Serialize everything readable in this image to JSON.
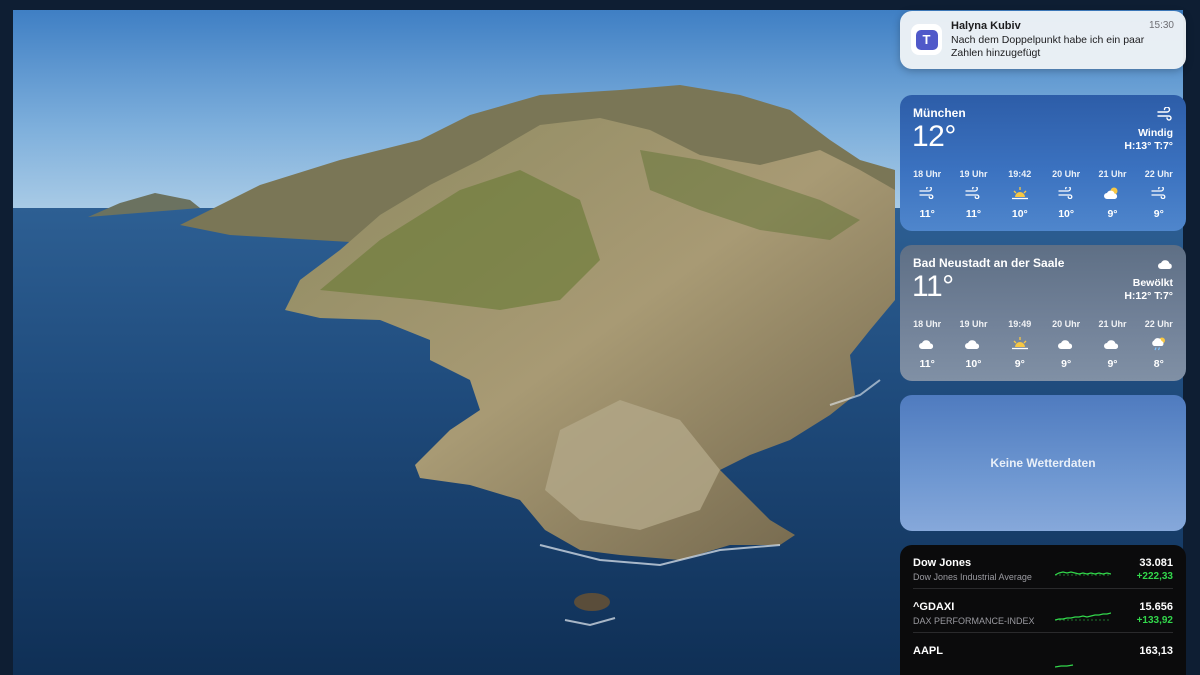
{
  "notification": {
    "app_icon": "microsoft-teams-icon",
    "sender": "Halyna Kubiv",
    "time": "15:30",
    "message": "Nach dem Doppelpunkt habe ich ein paar Zahlen hinzugefügt"
  },
  "weather": [
    {
      "city": "München",
      "temperature": "12°",
      "condition_icon": "wind-icon",
      "condition": "Windig",
      "hilo": "H:13° T:7°",
      "hours": [
        {
          "time": "18 Uhr",
          "icon": "wind-icon",
          "temp": "11°"
        },
        {
          "time": "19 Uhr",
          "icon": "wind-icon",
          "temp": "11°"
        },
        {
          "time": "19:42",
          "icon": "sunset-icon",
          "temp": "10°"
        },
        {
          "time": "20 Uhr",
          "icon": "wind-icon",
          "temp": "10°"
        },
        {
          "time": "21 Uhr",
          "icon": "partly-cloudy-icon",
          "temp": "9°"
        },
        {
          "time": "22 Uhr",
          "icon": "wind-icon",
          "temp": "9°"
        }
      ]
    },
    {
      "city": "Bad Neustadt an der Saale",
      "temperature": "11°",
      "condition_icon": "cloud-icon",
      "condition": "Bewölkt",
      "hilo": "H:12° T:7°",
      "hours": [
        {
          "time": "18 Uhr",
          "icon": "cloud-icon",
          "temp": "11°"
        },
        {
          "time": "19 Uhr",
          "icon": "cloud-icon",
          "temp": "10°"
        },
        {
          "time": "19:49",
          "icon": "sunset-icon",
          "temp": "9°"
        },
        {
          "time": "20 Uhr",
          "icon": "cloud-icon",
          "temp": "9°"
        },
        {
          "time": "21 Uhr",
          "icon": "cloud-icon",
          "temp": "9°"
        },
        {
          "time": "22 Uhr",
          "icon": "partly-cloudy-rain-icon",
          "temp": "8°"
        }
      ]
    }
  ],
  "weather_empty": {
    "message": "Keine Wetterdaten"
  },
  "stocks": [
    {
      "symbol": "Dow Jones",
      "name": "Dow Jones Industrial Average",
      "price": "33.081",
      "change": "+222,33"
    },
    {
      "symbol": "^GDAXI",
      "name": "DAX PERFORMANCE-INDEX",
      "price": "15.656",
      "change": "+133,92"
    },
    {
      "symbol": "AAPL",
      "name": "",
      "price": "163,13",
      "change": ""
    }
  ],
  "colors": {
    "stock_up": "#32d74b",
    "munich_widget": "#3b72c0",
    "bad_neustadt_widget": "#718198",
    "empty_widget": "#6e97d1"
  }
}
